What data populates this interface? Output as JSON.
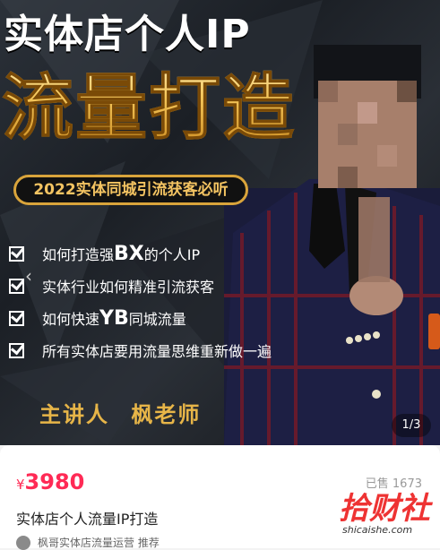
{
  "banner": {
    "title_line1": "实体店个人IP",
    "title_line2": "流量打造",
    "pill": "2022实体同城引流获客必听",
    "items": [
      {
        "pre": "如何打造强",
        "big": "BX",
        "post": "的个人IP"
      },
      {
        "pre": "实体行业如何精准引流获客",
        "big": "",
        "post": ""
      },
      {
        "pre": "如何快速",
        "big": "YB",
        "post": "同城流量"
      },
      {
        "pre": "所有实体店要用流量思维重新做一遍",
        "big": "",
        "post": ""
      }
    ],
    "lecturer": "主讲人 枫老师",
    "page_indicator": "1/3",
    "prev_icon": "chevron-left-icon"
  },
  "product": {
    "currency": "¥",
    "price": "3980",
    "sold": "已售 1673",
    "title": "实体店个人流量IP打造",
    "shop": "枫哥实体店流量运营 推荐"
  },
  "watermark": {
    "text": "拾财社",
    "url": "shicaishe.com"
  },
  "colors": {
    "gold": "#e7b548",
    "price": "#ff2a55"
  }
}
